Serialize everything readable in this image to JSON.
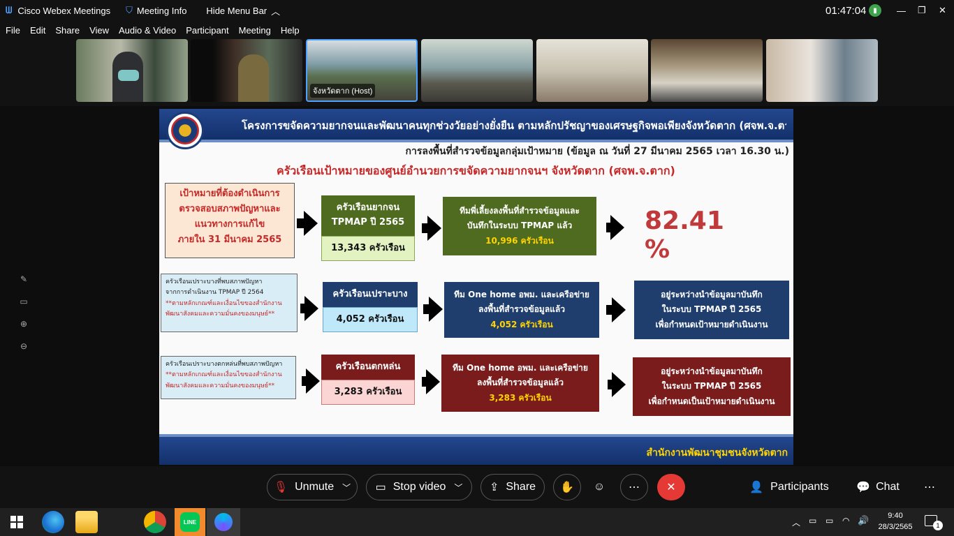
{
  "titlebar": {
    "app_name": "Cisco Webex Meetings",
    "meeting_info": "Meeting Info",
    "hide_menu": "Hide Menu Bar",
    "clock": "01:47:04"
  },
  "menu": [
    "File",
    "Edit",
    "Share",
    "View",
    "Audio & Video",
    "Participant",
    "Meeting",
    "Help"
  ],
  "thumbs": [
    {
      "label": ""
    },
    {
      "label": ""
    },
    {
      "label": "จังหวัดตาก (Host)"
    },
    {
      "label": ""
    },
    {
      "label": ""
    },
    {
      "label": ""
    },
    {
      "label": ""
    }
  ],
  "slide": {
    "header": "โครงการขจัดความยากจนและพัฒนาคนทุกช่วงวัยอย่างยั่งยืน ตามหลักปรัชญาของเศรษฐกิจพอเพียงจังหวัดตาก (ศจพ.จ.ตาก)",
    "subheader": "การลงพื้นที่สำรวจข้อมูลกลุ่มเป้าหมาย (ข้อมูล ณ วันที่ 27 มีนาคม 2565 เวลา 16.30 น.)",
    "title": "ครัวเรือนเป้าหมายของศูนย์อำนวยการขจัดความยากจนฯ จังหวัดตาก (ศจพ.จ.ตาก)",
    "row1": {
      "target_lines": [
        "เป้าหมายที่ต้องดำเนินการ",
        "ตรวจสอบสภาพปัญหาและ",
        "แนวทางการแก้ไข",
        "ภายใน 31 มีนาคม 2565"
      ],
      "box_top": [
        "ครัวเรือนยากจน",
        "TPMAP ปี 2565"
      ],
      "box_value": "13,343 ครัวเรือน",
      "team_lines": [
        "ทีมพี่เลี้ยงลงพื้นที่สำรวจข้อมูลและ",
        "บันทึกในระบบ TPMAP แล้ว"
      ],
      "team_value": "10,996 ครัวเรือน",
      "percent": "82.41 %"
    },
    "row2": {
      "note_lines": [
        "ครัวเรือนเปราะบางที่พบสภาพปัญหา",
        "จากการดำเนินงาน TPMAP ปี 2564"
      ],
      "note_red": [
        "**ตามหลักเกณฑ์และเงื่อนไขของสำนักงาน",
        "พัฒนาสังคมและความมั่นคงของมนุษย์**"
      ],
      "box_top": "ครัวเรือนเปราะบาง",
      "box_value": "4,052 ครัวเรือน",
      "team_lines": [
        "ทีม One home อพม. และเครือข่าย",
        "ลงพื้นที่สำรวจข้อมูลแล้ว"
      ],
      "team_value": "4,052 ครัวเรือน",
      "status_lines": [
        "อยู่ระหว่างนำข้อมูลมาบันทึก",
        "ในระบบ TPMAP ปี 2565",
        "เพื่อกำหนดเป้าหมายดำเนินงาน"
      ]
    },
    "row3": {
      "note_lines": [
        "ครัวเรือนเปราะบางตกหล่นที่พบสภาพปัญหา"
      ],
      "note_red": [
        "**ตามหลักเกณฑ์และเงื่อนไขของสำนักงาน",
        "พัฒนาสังคมและความมั่นคงของมนุษย์**"
      ],
      "box_top": "ครัวเรือนตกหล่น",
      "box_value": "3,283 ครัวเรือน",
      "team_lines": [
        "ทีม One home อพม. และเครือข่าย",
        "ลงพื้นที่สำรวจข้อมูลแล้ว"
      ],
      "team_value": "3,283 ครัวเรือน",
      "status_lines": [
        "อยู่ระหว่างนำข้อมูลมาบันทึก",
        "ในระบบ TPMAP ปี 2565",
        "เพื่อกำหนดเป็นเป้าหมายดำเนินงาน"
      ]
    },
    "footer": "สำนักงานพัฒนาชุมชนจังหวัดตาก"
  },
  "controls": {
    "unmute": "Unmute",
    "stop_video": "Stop video",
    "share": "Share",
    "participants": "Participants",
    "chat": "Chat"
  },
  "taskbar": {
    "time": "9:40",
    "date": "28/3/2565",
    "notif_count": "1"
  },
  "colors": {
    "green_box": "#4e6b1f",
    "blue_box": "#1f3e6e",
    "red_box": "#7a1c1c",
    "percent": "#c0393b",
    "header_band": "#1b3b78",
    "end_button": "#e53935"
  }
}
